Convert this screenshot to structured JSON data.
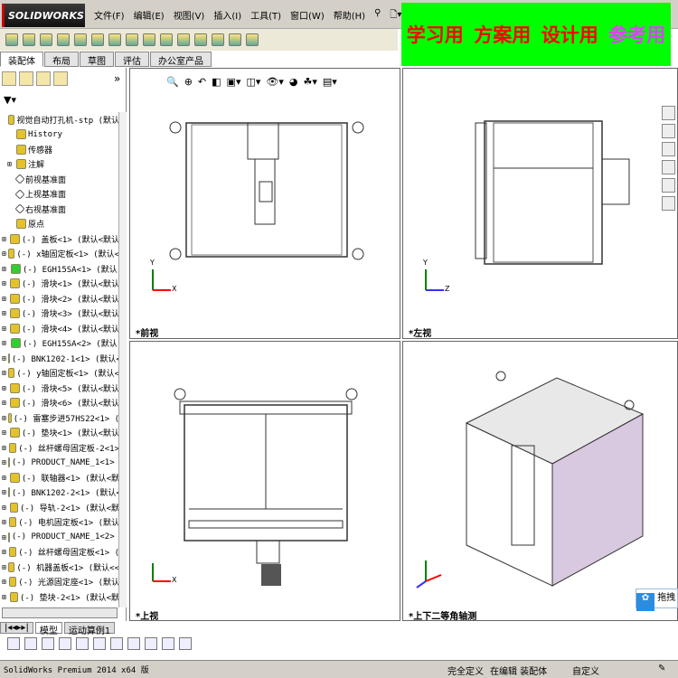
{
  "app": {
    "logo": "SOLIDWORKS",
    "menu": [
      "文件(F)",
      "编辑(E)",
      "视图(V)",
      "插入(I)",
      "工具(T)",
      "窗口(W)",
      "帮助(H)"
    ]
  },
  "tabs": [
    "装配体",
    "布局",
    "草图",
    "评估",
    "办公室产品"
  ],
  "banner": {
    "items": [
      {
        "text": "学习用",
        "color": "#ff0000"
      },
      {
        "text": "方案用",
        "color": "#ff0000"
      },
      {
        "text": "设计用",
        "color": "#ff0000"
      },
      {
        "text": "参考用",
        "color": "#e040fb"
      }
    ]
  },
  "tree": {
    "root": "视觉自动打孔机-stp (默认",
    "fixed": [
      "History",
      "传感器",
      "注解",
      "前视基准面",
      "上视基准面",
      "右视基准面",
      "原点"
    ],
    "parts": [
      "(-) 盖板<1> (默认<默认",
      "(-) x轴固定板<1> (默认<",
      "(-) EGH15SA<1> (默认",
      "(-) 滑块<1> (默认<默认",
      "(-) 滑块<2> (默认<默认",
      "(-) 滑块<3> (默认<默认",
      "(-) 滑块<4> (默认<默认",
      "(-) EGH15SA<2> (默认",
      "(-) BNK1202-1<1> (默认<",
      "(-) y轴固定板<1> (默认<",
      "(-) 滑块<5> (默认<默认",
      "(-) 滑块<6> (默认<默认",
      "(-) 雷塞步进57HS22<1> (",
      "(-) 垫块<1> (默认<默认",
      "(-) 丝杆螺母固定板-2<1>",
      "(-) PRODUCT_NAME_1<1> (",
      "(-) 联轴器<1> (默认<默",
      "(-) BNK1202-2<1> (默认<",
      "(-) 导轨-2<1> (默认<默",
      "(-) 电机固定板<1> (默认",
      "(-) PRODUCT_NAME_1<2> (",
      "(-) 丝杆螺母固定板<1> (",
      "(-) 机器盖板<1> (默认<<",
      "(-) 光源固定座<1> (默认",
      "(-) 垫块-2<1> (默认<默"
    ]
  },
  "views": {
    "front": "*前视",
    "left": "*左视",
    "top": "*上视",
    "iso": "*上下二等角轴测"
  },
  "axes": {
    "x": "X",
    "y": "Y",
    "z": "Z"
  },
  "bottom_tabs": [
    "模型",
    "运动算例1"
  ],
  "status": {
    "version": "SolidWorks Premium 2014 x64 版",
    "defined": "完全定义",
    "editing": "在编辑 装配体",
    "custom": "自定义"
  },
  "baidu": "拖拽"
}
